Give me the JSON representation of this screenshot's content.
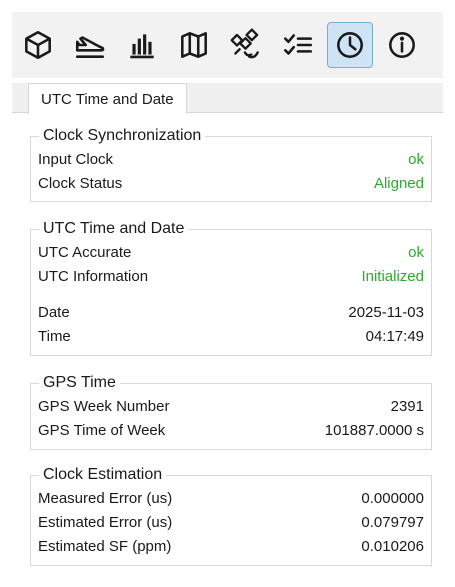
{
  "toolbar": {
    "icons": [
      "cube-icon",
      "airplane-icon",
      "chart-icon",
      "map-icon",
      "satellite-icon",
      "checklist-icon",
      "clock-icon",
      "info-icon"
    ],
    "active": "clock-icon"
  },
  "tab": {
    "label": "UTC Time and Date"
  },
  "clock_sync": {
    "title": "Clock Synchronization",
    "rows": [
      {
        "label": "Input Clock",
        "value": "ok"
      },
      {
        "label": "Clock Status",
        "value": "Aligned"
      }
    ]
  },
  "utc": {
    "title": "UTC Time and Date",
    "rows": [
      {
        "label": "UTC Accurate",
        "value": "ok"
      },
      {
        "label": "UTC Information",
        "value": "Initialized"
      },
      {
        "label": "Date",
        "value": "2025-11-03"
      },
      {
        "label": "Time",
        "value": "04:17:49"
      }
    ]
  },
  "gps": {
    "title": "GPS Time",
    "rows": [
      {
        "label": "GPS Week Number",
        "value": "2391"
      },
      {
        "label": "GPS Time of Week",
        "value": "101887.0000 s"
      }
    ]
  },
  "estimation": {
    "title": "Clock Estimation",
    "rows": [
      {
        "label": "Measured Error (us)",
        "value": "0.000000"
      },
      {
        "label": "Estimated Error (us)",
        "value": "0.079797"
      },
      {
        "label": "Estimated SF (ppm)",
        "value": "0.010206"
      }
    ]
  },
  "colors": {
    "status_ok": "#2bab2b",
    "active_bg": "#cfe3f7",
    "active_border": "#79acd9"
  }
}
